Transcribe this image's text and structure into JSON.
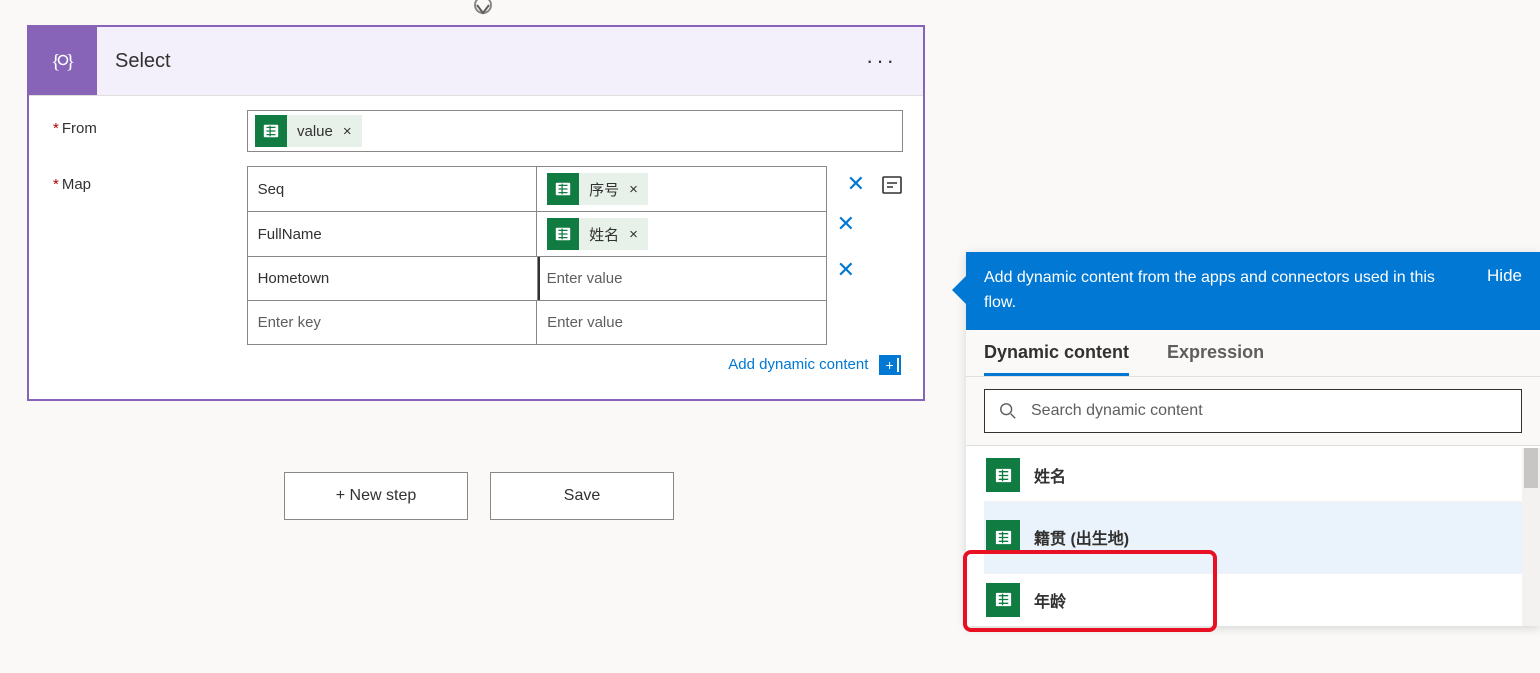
{
  "card": {
    "title": "Select",
    "fromLabel": "From",
    "mapLabel": "Map",
    "fromPill": "value",
    "rows": [
      {
        "key": "Seq",
        "valPill": "序号"
      },
      {
        "key": "FullName",
        "valPill": "姓名"
      },
      {
        "key": "Hometown",
        "valPill": null,
        "valPlaceholder": "Enter value",
        "focus": true
      }
    ],
    "emptyKeyPlaceholder": "Enter key",
    "emptyValPlaceholder": "Enter value",
    "addDynamic": "Add dynamic content"
  },
  "buttons": {
    "newStep": "+ New step",
    "save": "Save"
  },
  "dc": {
    "headText": "Add dynamic content from the apps and connectors used in this flow.",
    "hide": "Hide",
    "tabDynamic": "Dynamic content",
    "tabExpression": "Expression",
    "searchPlaceholder": "Search dynamic content",
    "items": [
      {
        "label": "姓名"
      },
      {
        "label": "籍贯 (出生地)",
        "highlighted": true
      },
      {
        "label": "年龄"
      }
    ]
  }
}
